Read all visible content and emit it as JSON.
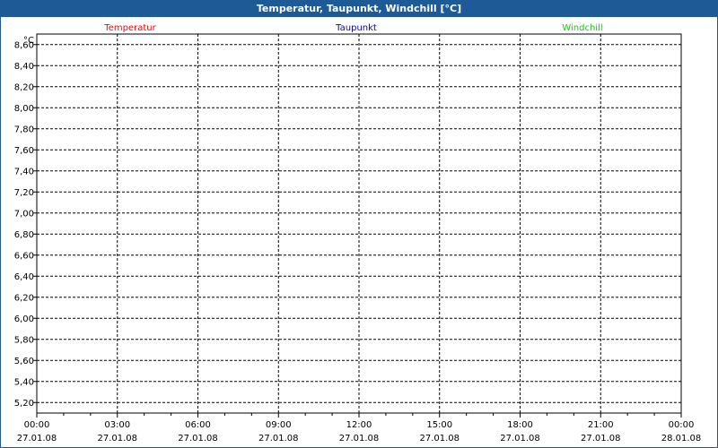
{
  "window": {
    "title": "Temperatur, Taupunkt, Windchill [°C]"
  },
  "colors": {
    "titlebar": "#1e5a96",
    "temperatur": "#ff0000",
    "taupunkt": "#0000cc",
    "windchill": "#22bb22"
  },
  "chart_data": {
    "type": "line",
    "title": "Temperatur, Taupunkt, Windchill [°C]",
    "unit_label": "°C",
    "ylim": [
      5.1,
      8.7
    ],
    "y_ticks": [
      "8,60",
      "8,40",
      "8,20",
      "8,00",
      "7,80",
      "7,60",
      "7,40",
      "7,20",
      "7,00",
      "6,80",
      "6,60",
      "6,40",
      "6,20",
      "6,00",
      "5,80",
      "5,60",
      "5,40",
      "5,20"
    ],
    "x_ticks": [
      {
        "time": "00:00",
        "date": "27.01.08"
      },
      {
        "time": "03:00",
        "date": "27.01.08"
      },
      {
        "time": "06:00",
        "date": "27.01.08"
      },
      {
        "time": "09:00",
        "date": "27.01.08"
      },
      {
        "time": "12:00",
        "date": "27.01.08"
      },
      {
        "time": "15:00",
        "date": "27.01.08"
      },
      {
        "time": "18:00",
        "date": "27.01.08"
      },
      {
        "time": "21:00",
        "date": "27.01.08"
      },
      {
        "time": "00:00",
        "date": "28.01.08"
      }
    ],
    "grid": true,
    "series": [
      {
        "name": "Temperatur",
        "color": "#ff0000",
        "values": []
      },
      {
        "name": "Taupunkt",
        "color": "#0000cc",
        "values": []
      },
      {
        "name": "Windchill",
        "color": "#22bb22",
        "values": []
      }
    ]
  }
}
